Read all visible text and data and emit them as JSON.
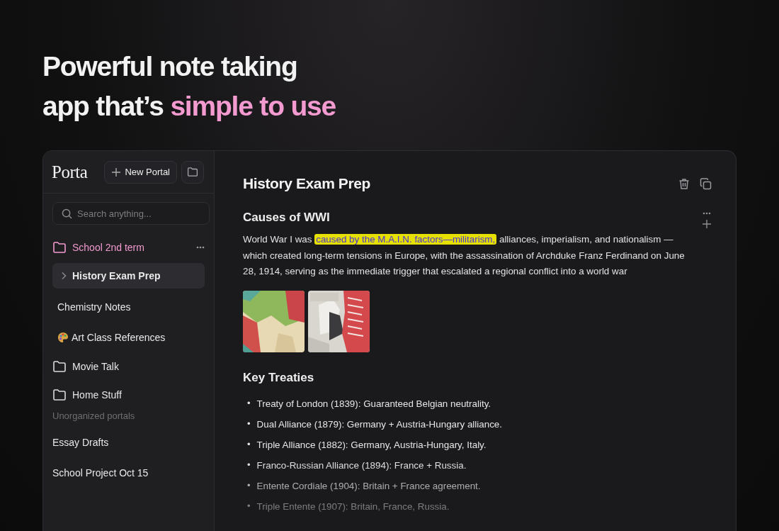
{
  "headline": {
    "line_1": "Powerful note taking",
    "line_2_plain": "app that’s ",
    "line_2_accent": "simple to use"
  },
  "sidebar": {
    "logo": "Porta",
    "new_button": "New Portal",
    "search": {
      "placeholder": "Search anything..."
    },
    "folders": [
      {
        "name": "School 2nd term",
        "expanded": true,
        "children": [
          {
            "name": "History Exam Prep",
            "selected": true,
            "expandable": true,
            "has_icon": false
          },
          {
            "name": "Chemistry Notes",
            "selected": false,
            "expandable": false,
            "has_icon": false
          },
          {
            "name": "Art Class References",
            "selected": false,
            "expandable": false,
            "has_icon": true
          }
        ]
      },
      {
        "name": "Movie Talk",
        "expanded": false
      },
      {
        "name": "Home Stuff",
        "expanded": false
      }
    ],
    "section_label": "Unorganized portals",
    "portals": [
      {
        "name": "Essay Drafts",
        "selected": false
      },
      {
        "name": "School Project Oct 15",
        "selected": false
      }
    ]
  },
  "note": {
    "title": "History Exam Prep",
    "sections": [
      {
        "kind": "paragraph",
        "heading": "Causes of WWI",
        "text_before": "World War I was ",
        "highlight": "caused by the M.A.I.N. factors—militarism,",
        "text_after": " alliances, imperialism, and nationalism —which created long-term tensions in Europe, with the assassination of Archduke Franz Ferdinand on June 28, 1914, serving as the immediate trigger that escalated a regional conflict into a world war"
      },
      {
        "kind": "list",
        "heading": "Key Treaties",
        "items": [
          {
            "bullet": "•",
            "text": "Treaty of London (1839): Guaranteed Belgian neutrality."
          },
          {
            "bullet": "•",
            "text": "Dual Alliance (1879): Germany + Austria-Hungary alliance."
          },
          {
            "bullet": "•",
            "text": "Triple Alliance (1882): Germany, Austria-Hungary, Italy."
          },
          {
            "bullet": "•",
            "text": "Franco-Russian Alliance (1894): France + Russia."
          },
          {
            "bullet": "•",
            "text": "Entente Cordiale (1904): Britain + France agreement."
          },
          {
            "bullet": "•",
            "text": "Triple Entente (1907): Britain, France, Russia."
          }
        ]
      }
    ]
  }
}
